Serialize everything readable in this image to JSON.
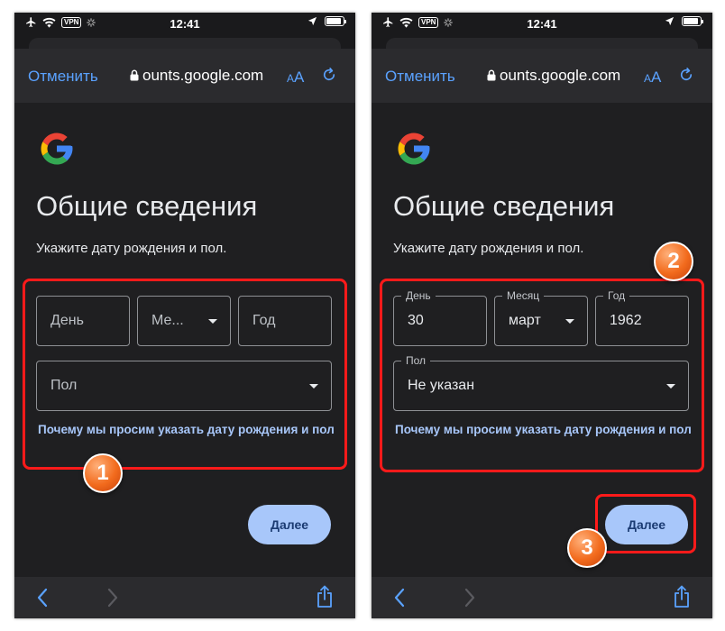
{
  "colors": {
    "link_blue": "#5aa2ff",
    "button_blue": "#a8c7fa",
    "highlight_red": "#ff1a1a",
    "badge_orange": "#f26b1d"
  },
  "status_bar": {
    "time": "12:41",
    "vpn_label": "VPN",
    "icons": [
      "airplane-icon",
      "wifi-icon",
      "loading-icon",
      "location-icon",
      "battery-icon"
    ]
  },
  "browser": {
    "cancel_label": "Отменить",
    "url": "ounts.google.com",
    "text_size_small": "A",
    "text_size_large": "A"
  },
  "phones": [
    {
      "title": "Общие сведения",
      "subtitle": "Укажите дату рождения и пол.",
      "day": {
        "label": "",
        "value": "",
        "placeholder": "День"
      },
      "month": {
        "label": "",
        "value": "",
        "placeholder": "Ме..."
      },
      "year": {
        "label": "",
        "value": "",
        "placeholder": "Год"
      },
      "gender": {
        "label": "",
        "value": "",
        "placeholder": "Пол"
      },
      "why_link": "Почему мы просим указать дату рождения и пол",
      "next_label": "Далее"
    },
    {
      "title": "Общие сведения",
      "subtitle": "Укажите дату рождения и пол.",
      "day": {
        "label": "День",
        "value": "30",
        "placeholder": ""
      },
      "month": {
        "label": "Месяц",
        "value": "март",
        "placeholder": ""
      },
      "year": {
        "label": "Год",
        "value": "1962",
        "placeholder": ""
      },
      "gender": {
        "label": "Пол",
        "value": "Не указан",
        "placeholder": ""
      },
      "why_link": "Почему мы просим указать дату рождения и пол",
      "next_label": "Далее"
    }
  ],
  "annotations": {
    "step1": "1",
    "step2": "2",
    "step3": "3"
  }
}
